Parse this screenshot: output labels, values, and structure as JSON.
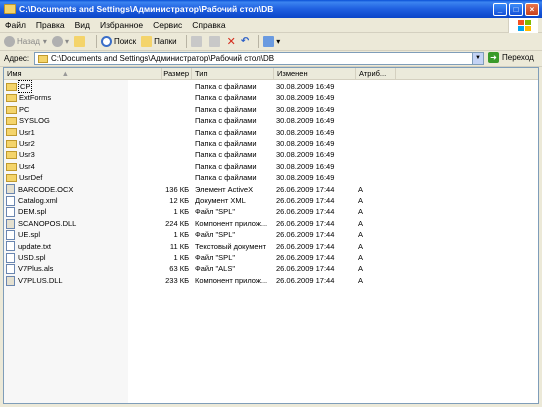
{
  "window": {
    "title": "C:\\Documents and Settings\\Администратор\\Рабочий стол\\DB",
    "min_glyph": "_",
    "max_glyph": "□",
    "close_glyph": "×"
  },
  "menu": [
    "Файл",
    "Правка",
    "Вид",
    "Избранное",
    "Сервис",
    "Справка"
  ],
  "toolbar": {
    "back_label": "Назад",
    "search_label": "Поиск",
    "folders_label": "Папки"
  },
  "address": {
    "label": "Адрес:",
    "value": "C:\\Documents and Settings\\Администратор\\Рабочий стол\\DB",
    "go_label": "Переход"
  },
  "columns": {
    "name": "Имя",
    "size": "Размер",
    "type": "Тип",
    "modified": "Изменен",
    "attr": "Атриб..."
  },
  "files": [
    {
      "name": "CP",
      "size": "",
      "type": "Папка с файлами",
      "modified": "30.08.2009 16:49",
      "attr": "",
      "icon": "folder"
    },
    {
      "name": "ExtForms",
      "size": "",
      "type": "Папка с файлами",
      "modified": "30.08.2009 16:49",
      "attr": "",
      "icon": "folder"
    },
    {
      "name": "PC",
      "size": "",
      "type": "Папка с файлами",
      "modified": "30.08.2009 16:49",
      "attr": "",
      "icon": "folder"
    },
    {
      "name": "SYSLOG",
      "size": "",
      "type": "Папка с файлами",
      "modified": "30.08.2009 16:49",
      "attr": "",
      "icon": "folder"
    },
    {
      "name": "Usr1",
      "size": "",
      "type": "Папка с файлами",
      "modified": "30.08.2009 16:49",
      "attr": "",
      "icon": "folder"
    },
    {
      "name": "Usr2",
      "size": "",
      "type": "Папка с файлами",
      "modified": "30.08.2009 16:49",
      "attr": "",
      "icon": "folder"
    },
    {
      "name": "Usr3",
      "size": "",
      "type": "Папка с файлами",
      "modified": "30.08.2009 16:49",
      "attr": "",
      "icon": "folder"
    },
    {
      "name": "Usr4",
      "size": "",
      "type": "Папка с файлами",
      "modified": "30.08.2009 16:49",
      "attr": "",
      "icon": "folder"
    },
    {
      "name": "UsrDef",
      "size": "",
      "type": "Папка с файлами",
      "modified": "30.08.2009 16:49",
      "attr": "",
      "icon": "folder"
    },
    {
      "name": "BARCODE.OCX",
      "size": "136 КБ",
      "type": "Элемент ActiveX",
      "modified": "26.06.2009 17:44",
      "attr": "A",
      "icon": "dll"
    },
    {
      "name": "Catalog.xml",
      "size": "12 КБ",
      "type": "Документ XML",
      "modified": "26.06.2009 17:44",
      "attr": "A",
      "icon": "doc"
    },
    {
      "name": "DEM.spl",
      "size": "1 КБ",
      "type": "Файл \"SPL\"",
      "modified": "26.06.2009 17:44",
      "attr": "A",
      "icon": "doc"
    },
    {
      "name": "SCANOPOS.DLL",
      "size": "224 КБ",
      "type": "Компонент прилож...",
      "modified": "26.06.2009 17:44",
      "attr": "A",
      "icon": "dll"
    },
    {
      "name": "UE.spl",
      "size": "1 КБ",
      "type": "Файл \"SPL\"",
      "modified": "26.06.2009 17:44",
      "attr": "A",
      "icon": "doc"
    },
    {
      "name": "update.txt",
      "size": "11 КБ",
      "type": "Текстовый документ",
      "modified": "26.06.2009 17:44",
      "attr": "A",
      "icon": "doc"
    },
    {
      "name": "USD.spl",
      "size": "1 КБ",
      "type": "Файл \"SPL\"",
      "modified": "26.06.2009 17:44",
      "attr": "A",
      "icon": "doc"
    },
    {
      "name": "V7Plus.als",
      "size": "63 КБ",
      "type": "Файл \"ALS\"",
      "modified": "26.06.2009 17:44",
      "attr": "A",
      "icon": "doc"
    },
    {
      "name": "V7PLUS.DLL",
      "size": "233 КБ",
      "type": "Компонент прилож...",
      "modified": "26.06.2009 17:44",
      "attr": "A",
      "icon": "dll"
    }
  ]
}
